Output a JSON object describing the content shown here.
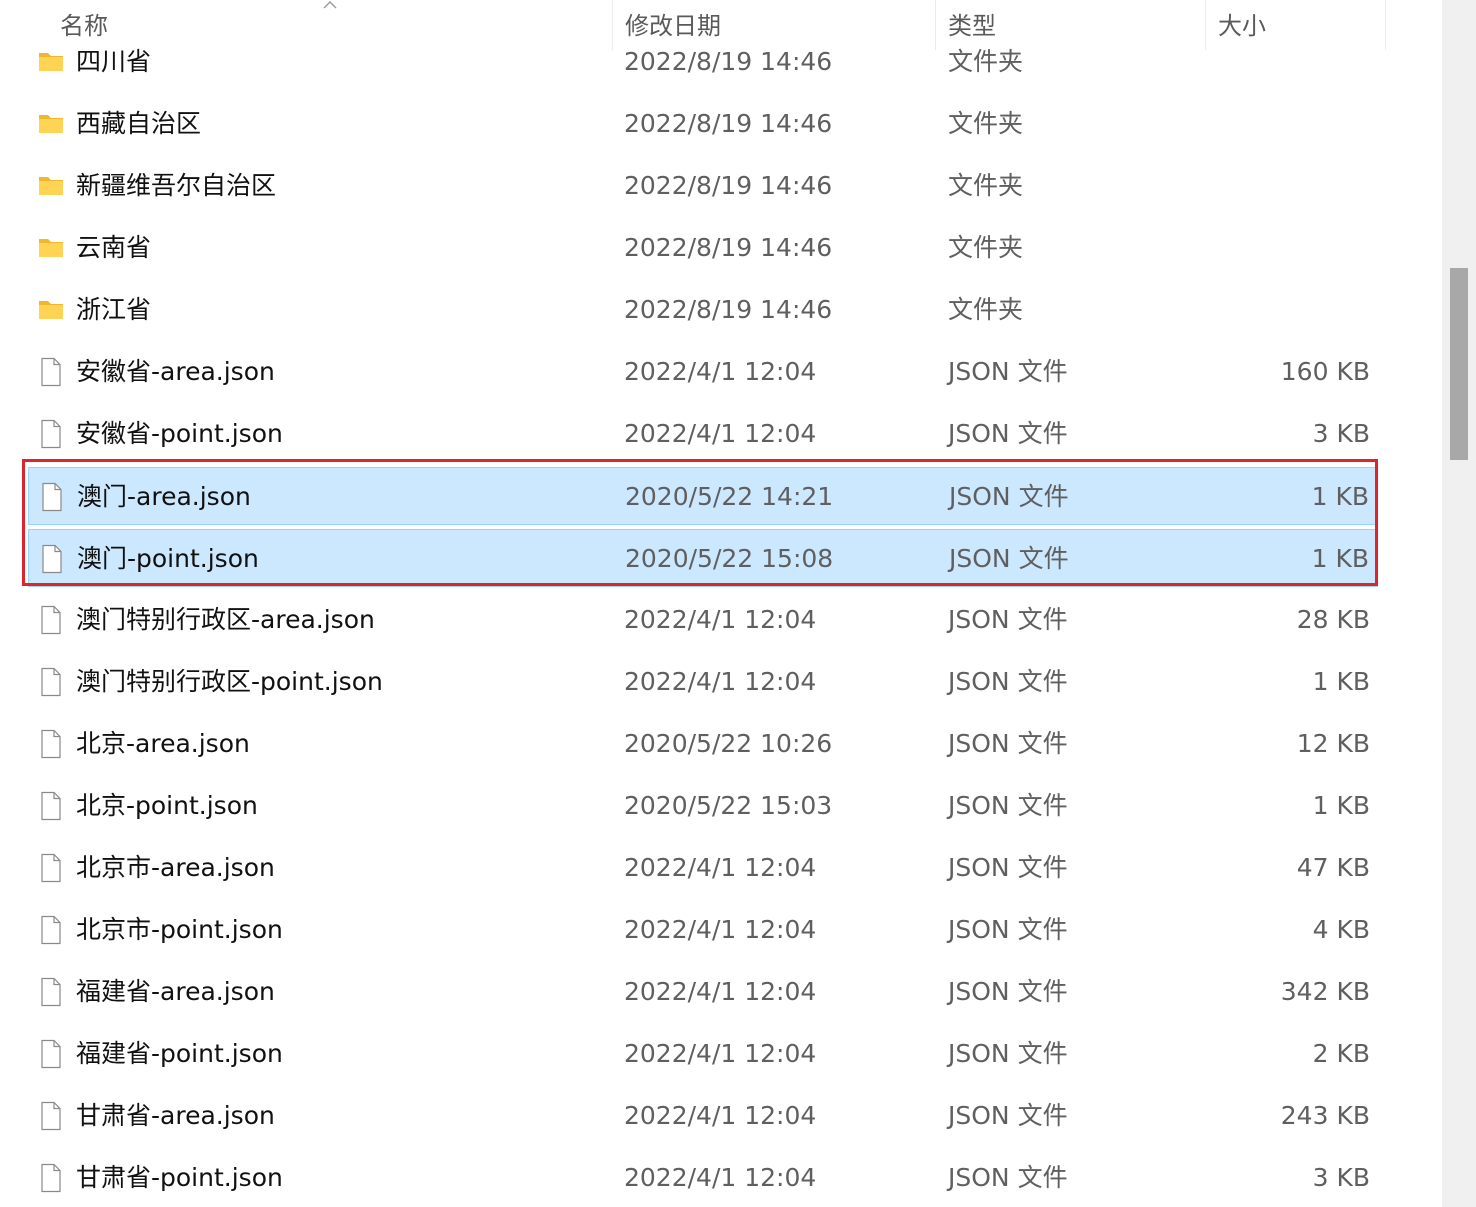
{
  "columns": {
    "name": "名称",
    "date": "修改日期",
    "type": "类型",
    "size": "大小"
  },
  "files": [
    {
      "name": "四川省",
      "date": "2022/8/19 14:46",
      "type": "文件夹",
      "size": "",
      "kind": "folder",
      "selected": false
    },
    {
      "name": "西藏自治区",
      "date": "2022/8/19 14:46",
      "type": "文件夹",
      "size": "",
      "kind": "folder",
      "selected": false
    },
    {
      "name": "新疆维吾尔自治区",
      "date": "2022/8/19 14:46",
      "type": "文件夹",
      "size": "",
      "kind": "folder",
      "selected": false
    },
    {
      "name": "云南省",
      "date": "2022/8/19 14:46",
      "type": "文件夹",
      "size": "",
      "kind": "folder",
      "selected": false
    },
    {
      "name": "浙江省",
      "date": "2022/8/19 14:46",
      "type": "文件夹",
      "size": "",
      "kind": "folder",
      "selected": false
    },
    {
      "name": "安徽省-area.json",
      "date": "2022/4/1 12:04",
      "type": "JSON 文件",
      "size": "160 KB",
      "kind": "file",
      "selected": false
    },
    {
      "name": "安徽省-point.json",
      "date": "2022/4/1 12:04",
      "type": "JSON 文件",
      "size": "3 KB",
      "kind": "file",
      "selected": false
    },
    {
      "name": "澳门-area.json",
      "date": "2020/5/22 14:21",
      "type": "JSON 文件",
      "size": "1 KB",
      "kind": "file",
      "selected": true
    },
    {
      "name": "澳门-point.json",
      "date": "2020/5/22 15:08",
      "type": "JSON 文件",
      "size": "1 KB",
      "kind": "file",
      "selected": true
    },
    {
      "name": "澳门特别行政区-area.json",
      "date": "2022/4/1 12:04",
      "type": "JSON 文件",
      "size": "28 KB",
      "kind": "file",
      "selected": false
    },
    {
      "name": "澳门特别行政区-point.json",
      "date": "2022/4/1 12:04",
      "type": "JSON 文件",
      "size": "1 KB",
      "kind": "file",
      "selected": false
    },
    {
      "name": "北京-area.json",
      "date": "2020/5/22 10:26",
      "type": "JSON 文件",
      "size": "12 KB",
      "kind": "file",
      "selected": false
    },
    {
      "name": "北京-point.json",
      "date": "2020/5/22 15:03",
      "type": "JSON 文件",
      "size": "1 KB",
      "kind": "file",
      "selected": false
    },
    {
      "name": "北京市-area.json",
      "date": "2022/4/1 12:04",
      "type": "JSON 文件",
      "size": "47 KB",
      "kind": "file",
      "selected": false
    },
    {
      "name": "北京市-point.json",
      "date": "2022/4/1 12:04",
      "type": "JSON 文件",
      "size": "4 KB",
      "kind": "file",
      "selected": false
    },
    {
      "name": "福建省-area.json",
      "date": "2022/4/1 12:04",
      "type": "JSON 文件",
      "size": "342 KB",
      "kind": "file",
      "selected": false
    },
    {
      "name": "福建省-point.json",
      "date": "2022/4/1 12:04",
      "type": "JSON 文件",
      "size": "2 KB",
      "kind": "file",
      "selected": false
    },
    {
      "name": "甘肃省-area.json",
      "date": "2022/4/1 12:04",
      "type": "JSON 文件",
      "size": "243 KB",
      "kind": "file",
      "selected": false
    },
    {
      "name": "甘肃省-point.json",
      "date": "2022/4/1 12:04",
      "type": "JSON 文件",
      "size": "3 KB",
      "kind": "file",
      "selected": false
    }
  ],
  "colors": {
    "selected_bg": "#cce8ff",
    "selected_border": "#99d1ff",
    "highlight": "#e0242c",
    "folder": "#ffc83d"
  }
}
